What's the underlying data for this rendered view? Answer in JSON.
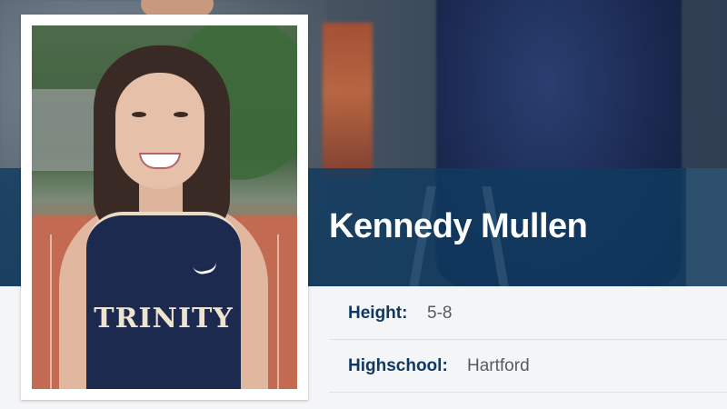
{
  "player": {
    "name": "Kennedy Mullen",
    "jersey_text": "TRINITY"
  },
  "details": [
    {
      "label": "Height:",
      "value": "5-8"
    },
    {
      "label": "Highschool:",
      "value": "Hartford"
    }
  ],
  "colors": {
    "navy": "#113860",
    "band": "#103a60",
    "text_muted": "#555b61"
  }
}
